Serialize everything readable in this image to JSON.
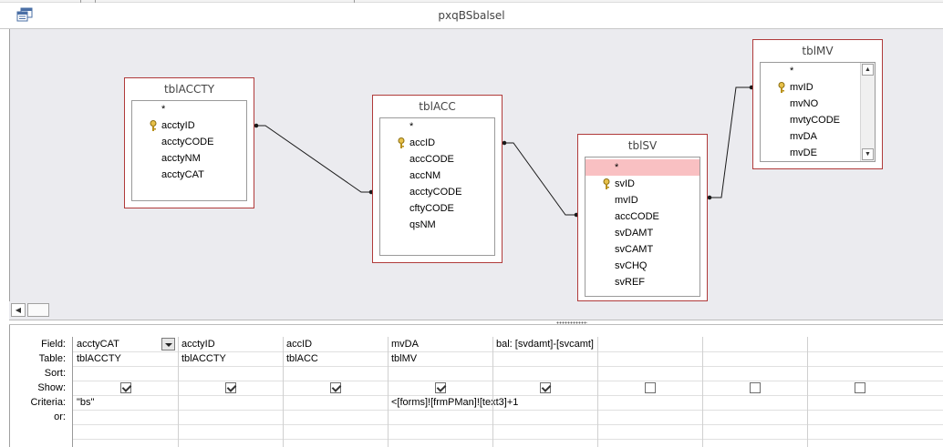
{
  "window": {
    "title": "pxqBSbalsel",
    "icon": "query-design-icon"
  },
  "tables": [
    {
      "name": "tblACCTY",
      "fields": [
        "*",
        "acctyID",
        "acctyCODE",
        "acctyNM",
        "acctyCAT"
      ],
      "key_field": "acctyID"
    },
    {
      "name": "tblACC",
      "fields": [
        "*",
        "accID",
        "accCODE",
        "accNM",
        "acctyCODE",
        "cftyCODE",
        "qsNM"
      ],
      "key_field": "accID"
    },
    {
      "name": "tblSV",
      "fields": [
        "*",
        "svID",
        "mvID",
        "accCODE",
        "svDAMT",
        "svCAMT",
        "svCHQ",
        "svREF"
      ],
      "key_field": "svID",
      "selected_field": "*"
    },
    {
      "name": "tblMV",
      "fields": [
        "*",
        "mvID",
        "mvNO",
        "mvtyCODE",
        "mvDA",
        "mvDE"
      ],
      "key_field": "mvID"
    }
  ],
  "grid": {
    "row_labels": {
      "field": "Field:",
      "table": "Table:",
      "sort": "Sort:",
      "show": "Show:",
      "criteria": "Criteria:",
      "or": "or:"
    },
    "columns": [
      {
        "field": "acctyCAT",
        "table": "tblACCTY",
        "sort": "",
        "show": true,
        "criteria": "\"bs\"",
        "or": ""
      },
      {
        "field": "acctyID",
        "table": "tblACCTY",
        "sort": "",
        "show": true,
        "criteria": "",
        "or": ""
      },
      {
        "field": "accID",
        "table": "tblACC",
        "sort": "",
        "show": true,
        "criteria": "",
        "or": ""
      },
      {
        "field": "mvDA",
        "table": "tblMV",
        "sort": "",
        "show": true,
        "criteria": "<[forms]![frmPMan]![text3]+1",
        "or": ""
      },
      {
        "field": "bal: [svdamt]-[svcamt]",
        "table": "",
        "sort": "",
        "show": true,
        "criteria": "",
        "or": ""
      },
      {
        "field": "",
        "table": "",
        "sort": "",
        "show": false,
        "criteria": "",
        "or": ""
      },
      {
        "field": "",
        "table": "",
        "sort": "",
        "show": false,
        "criteria": "",
        "or": ""
      },
      {
        "field": "",
        "table": "",
        "sort": "",
        "show": false,
        "criteria": "",
        "or": ""
      }
    ]
  },
  "colors": {
    "table_border": "#b03a3a",
    "selected_field": "#f9c0c2",
    "diagram_background": "#ebebef",
    "key_icon": "#c9a227"
  },
  "icons": {
    "key": "primary-key-icon",
    "scroll_left": "scroll-left-arrow-icon",
    "scroll_up": "scroll-up-arrow-icon",
    "scroll_down": "scroll-down-arrow-icon",
    "dropdown": "dropdown-arrow-icon"
  }
}
